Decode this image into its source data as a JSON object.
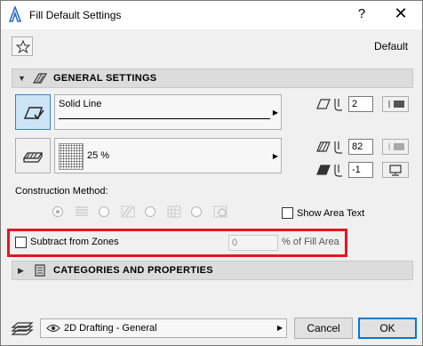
{
  "window": {
    "title": "Fill Default Settings",
    "help_label": "?",
    "close_label": "✕"
  },
  "header": {
    "default_label": "Default"
  },
  "general": {
    "title": "GENERAL SETTINGS",
    "line_type": "Solid Line",
    "fill_pattern": "25 %",
    "pen_contour": "2",
    "pen_fill": "82",
    "pen_background": "-1"
  },
  "construction": {
    "label": "Construction Method:",
    "show_area_text_label": "Show Area Text",
    "show_area_text_checked": false
  },
  "zones": {
    "subtract_label": "Subtract from Zones",
    "subtract_checked": false,
    "value": "0",
    "suffix": "% of Fill Area"
  },
  "categories": {
    "title": "CATEGORIES AND PROPERTIES"
  },
  "footer": {
    "layer": "2D Drafting - General",
    "cancel_label": "Cancel",
    "ok_label": "OK"
  },
  "colors": {
    "highlight": "#e8141b",
    "selected": "#cde4f7",
    "accent": "#0078d7"
  }
}
